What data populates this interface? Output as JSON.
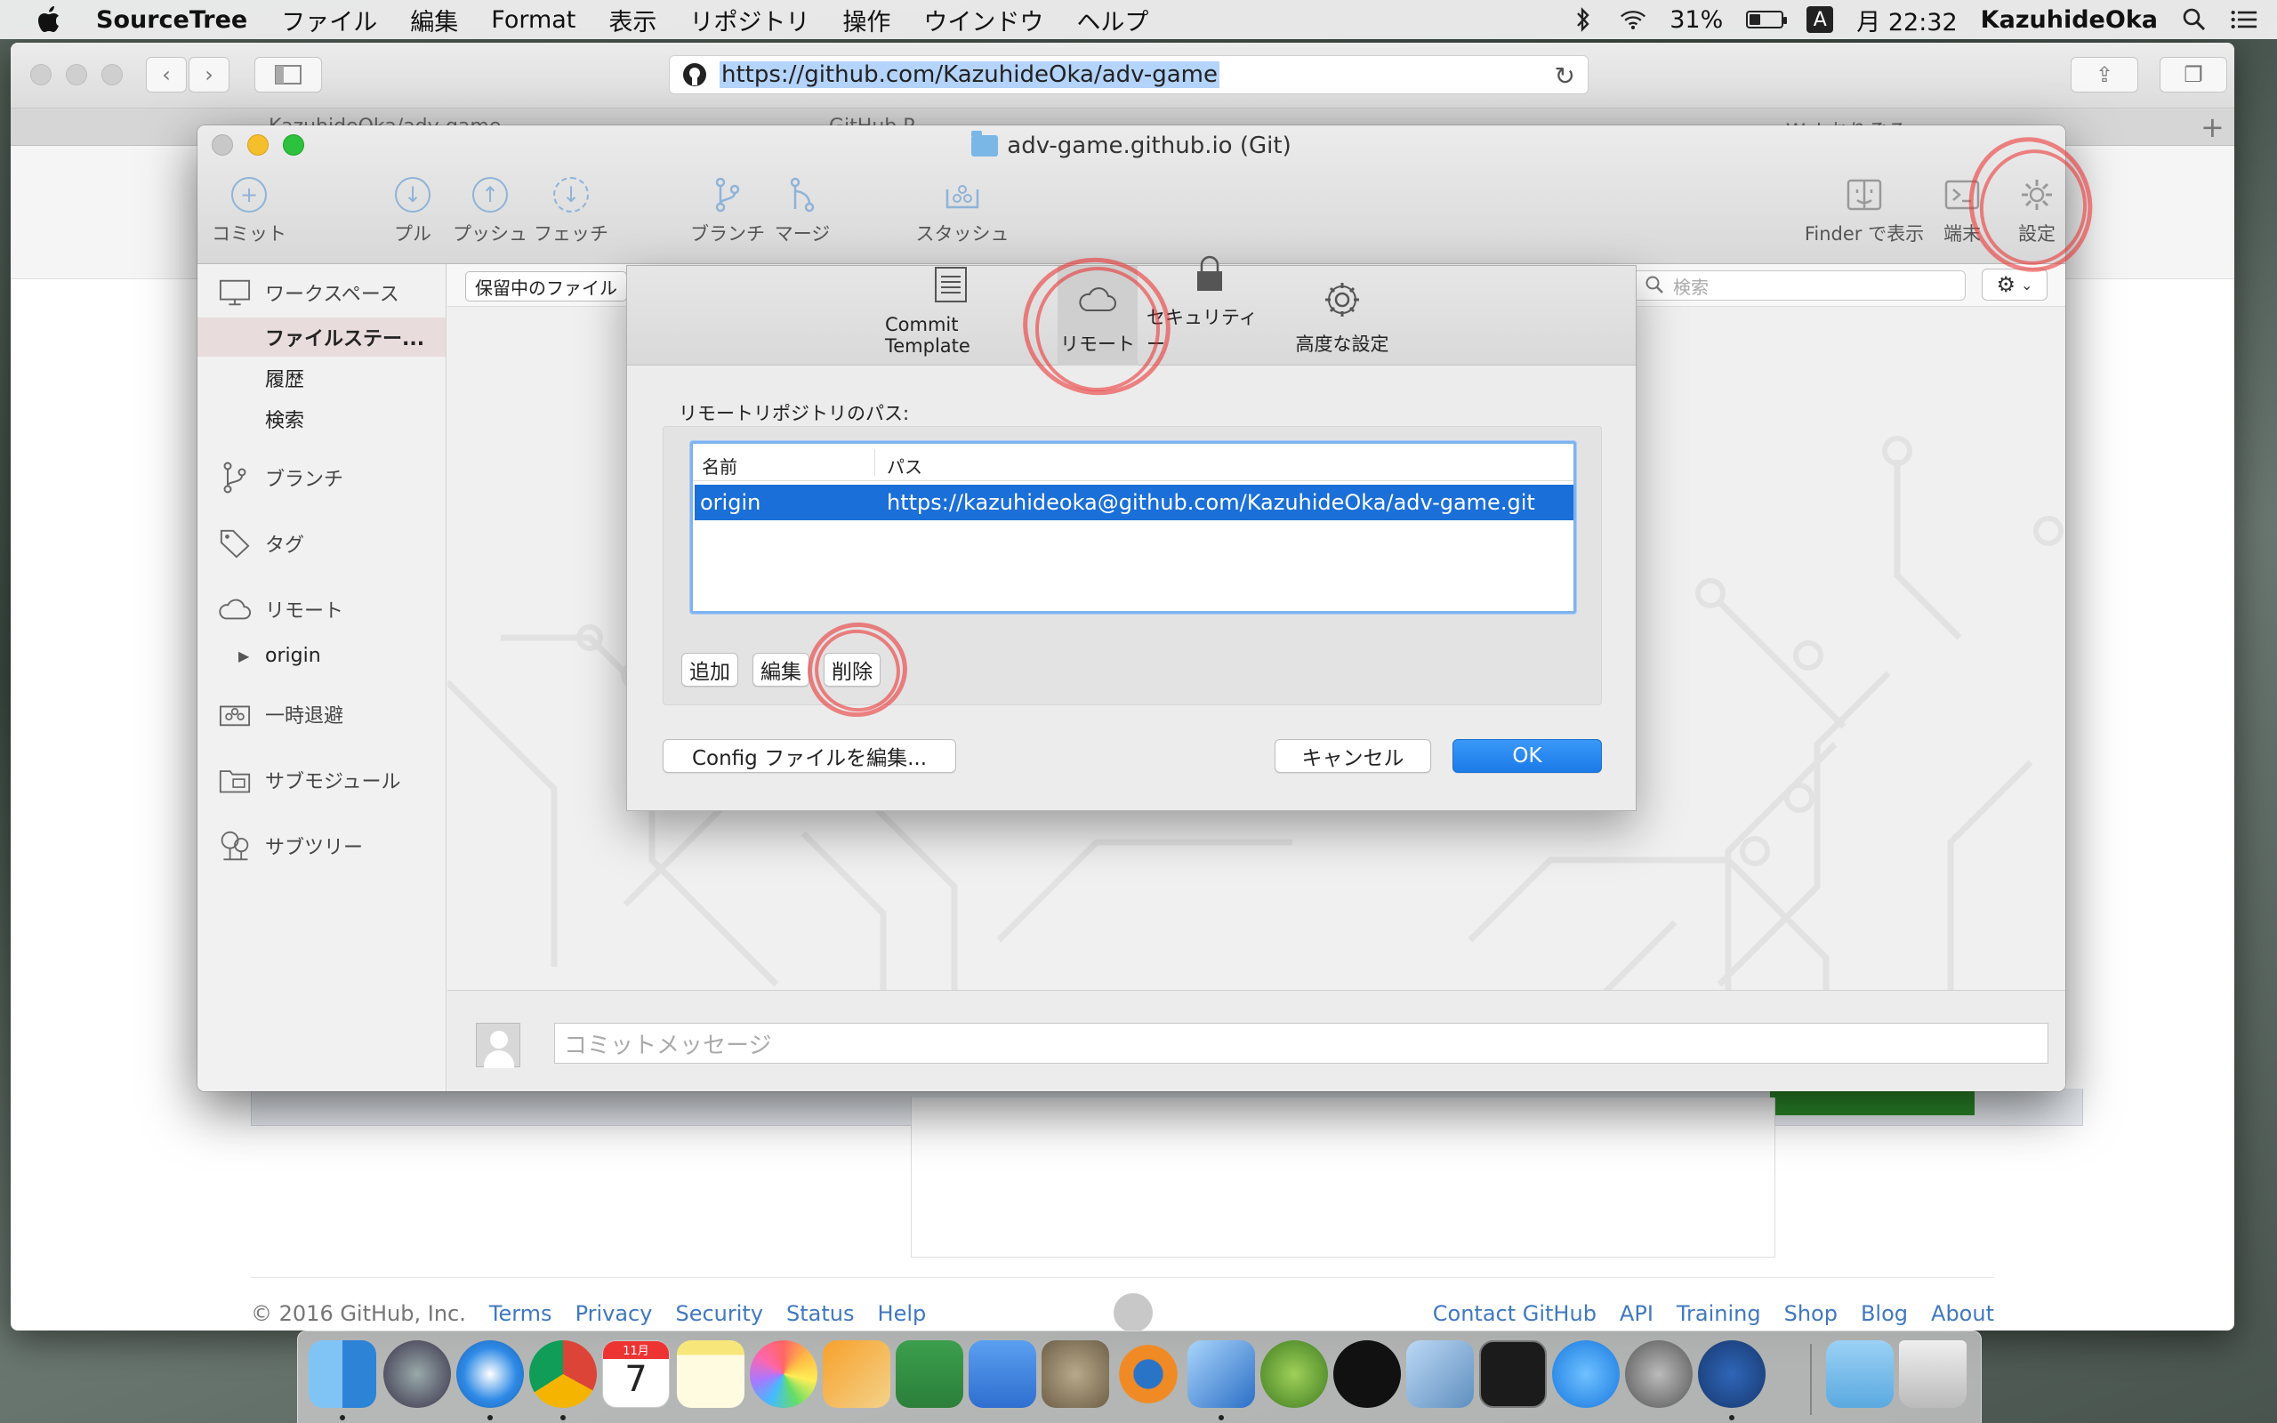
{
  "menubar": {
    "app_name": "SourceTree",
    "menus": [
      "ファイル",
      "編集",
      "Format",
      "表示",
      "リポジトリ",
      "操作",
      "ウインドウ",
      "ヘルプ"
    ],
    "battery": "31%",
    "battery_level": 0.31,
    "input_method": "A",
    "clock": "月 22:32",
    "user": "KazuhideOka"
  },
  "safari": {
    "url": "https://github.com/KazuhideOka/adv-game",
    "tabs": [
      "KazuhideOka/adv-game",
      "GitHub P...",
      "Webおりぞる"
    ],
    "footer": {
      "copyright": "© 2016 GitHub, Inc.",
      "left_links": [
        "Terms",
        "Privacy",
        "Security",
        "Status",
        "Help"
      ],
      "right_links": [
        "Contact GitHub",
        "API",
        "Training",
        "Shop",
        "Blog",
        "About"
      ]
    }
  },
  "sourcetree": {
    "window_title": "adv-game.github.io (Git)",
    "toolbar": {
      "commit": "コミット",
      "pull": "プル",
      "push": "プッシュ",
      "fetch": "フェッチ",
      "branch": "ブランチ",
      "merge": "マージ",
      "stash": "スタッシュ",
      "show_in_finder": "Finder で表示",
      "terminal": "端末",
      "settings": "設定"
    },
    "sidebar": {
      "workspace": "ワークスペース",
      "file_status": "ファイルステー...",
      "history": "履歴",
      "search": "検索",
      "branches": "ブランチ",
      "tags": "タグ",
      "remotes": "リモート",
      "origin": "origin",
      "stashes": "一時退避",
      "submodules": "サブモジュール",
      "subtrees": "サブツリー"
    },
    "pending_files_select": "保留中のファイル",
    "search_placeholder": "検索",
    "commit_message_placeholder": "コミットメッセージ"
  },
  "settings_dialog": {
    "tabs": [
      "Commit Template",
      "リモート",
      "セキュリティー",
      "高度な設定"
    ],
    "active_tab": "リモート",
    "remote_paths_label": "リモートリポジトリのパス:",
    "table": {
      "columns": [
        "名前",
        "パス"
      ],
      "rows": [
        {
          "name": "origin",
          "path": "https://kazuhideoka@github.com/KazuhideOka/adv-game.git"
        }
      ]
    },
    "add_button": "追加",
    "edit_button": "編集",
    "delete_button": "削除",
    "edit_config_button": "Config ファイルを編集...",
    "cancel_button": "キャンセル",
    "ok_button": "OK"
  },
  "dock": {
    "calendar_month": "11月",
    "calendar_day": "7",
    "apps": [
      "finder",
      "launchpad",
      "safari",
      "chrome",
      "calendar",
      "notes",
      "photos",
      "pages",
      "numbers",
      "keynote",
      "gimp",
      "blender",
      "xcode",
      "android-studio",
      "b3",
      "virtualbox",
      "terminal",
      "app-store",
      "system-preferences",
      "sourcetree",
      "downloads",
      "trash"
    ]
  },
  "colors": {
    "selection_blue": "#1a6fd8",
    "ok_button_blue": "#2a8af0",
    "annotation_red": "#ec2828",
    "focus_ring": "#7eb3f0"
  }
}
